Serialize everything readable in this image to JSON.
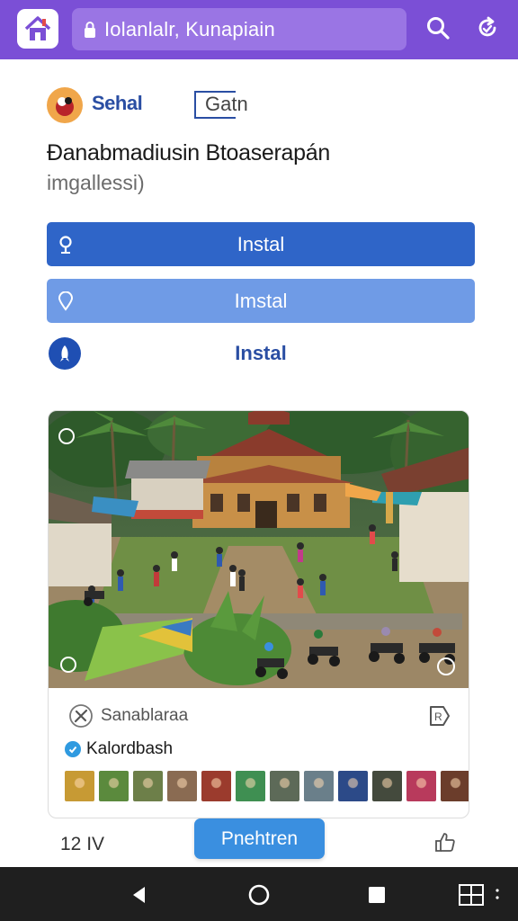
{
  "topbar": {
    "search_text": "Iolanlalr, Kunapiain",
    "home_icon": "home-icon",
    "search_icon": "search-icon",
    "refresh_icon": "refresh-icon",
    "bar_color": "#7b4fd6"
  },
  "header": {
    "brand_name": "Sehal",
    "get_label": "Gatn",
    "app_title": "Đanabmadiusin Btoaserapán",
    "app_subtitle": "imgallessi)"
  },
  "install_buttons": [
    {
      "label": "Instal",
      "icon": "location-pin-icon",
      "color": "#2f65c8"
    },
    {
      "label": "Imstal",
      "icon": "location-outline-icon",
      "color": "#6f9be6"
    },
    {
      "label": "Instal",
      "icon": "rocket-icon",
      "color": "#1f4fb3"
    }
  ],
  "card": {
    "source_label": "Sanablaraa",
    "author_label": "Kalordbash",
    "thumb_colors": [
      "#c79a34",
      "#5b8a3d",
      "#6d7f49",
      "#8a6b52",
      "#9b3b2d",
      "#3f8f52",
      "#5d6a58",
      "#6a7f8a",
      "#2c4a88",
      "#444a3d",
      "#b83a5c",
      "#6b3d2b",
      "#4a4a4a"
    ]
  },
  "footer": {
    "count": "12 IV",
    "preview_label": "Pnehtren"
  },
  "navbar": {
    "back_icon": "back-triangle-icon",
    "home_icon": "circle-home-icon",
    "recents_icon": "square-recents-icon",
    "grid_icon": "grid-icon"
  }
}
